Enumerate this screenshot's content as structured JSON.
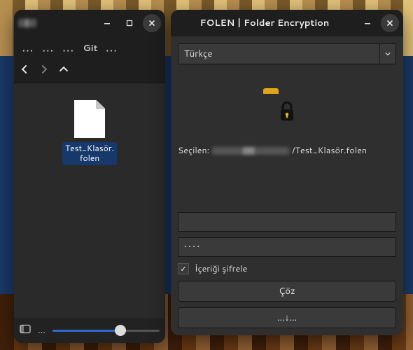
{
  "fm": {
    "title_redacted": true,
    "breadcrumb_dots": "...",
    "breadcrumb_visible": "Git",
    "file_label": "Test_Klasör.\nfolen",
    "zoom_percent": 62
  },
  "folen": {
    "title": "FOLEN | Folder Encryption",
    "language": "Türkçe",
    "selected_label": "Seçilen:",
    "selected_path_redacted": true,
    "selected_tail": "/Test_Klasör.folen",
    "password_mask": "••••",
    "encrypt_checkbox_label": "İçeriği şifrele",
    "encrypt_checked": true,
    "decrypt_button": "Çöz",
    "save_to_button": "...↓..."
  }
}
